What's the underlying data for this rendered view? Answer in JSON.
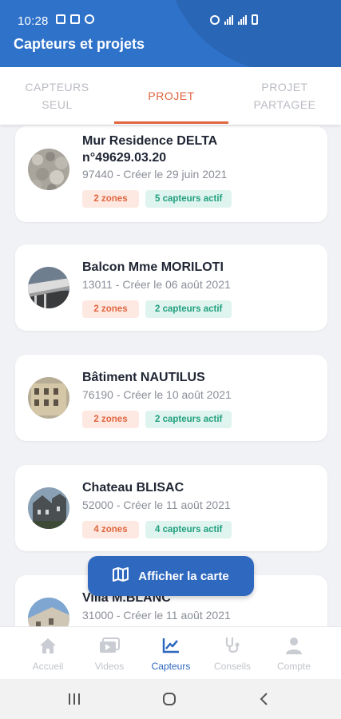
{
  "status": {
    "time": "10:28"
  },
  "header": {
    "title": "Capteurs et projets"
  },
  "tabs": [
    {
      "line1": "CAPTEURS",
      "line2": "SEUL"
    },
    {
      "line1": "PROJET",
      "line2": ""
    },
    {
      "line1": "PROJET",
      "line2": "PARTAGEE"
    }
  ],
  "projects": [
    {
      "name_line1": "Mur Residence DELTA",
      "name_line2": "n°49629.03.20",
      "subtitle": "97440 - Créer le 29 juin 2021",
      "zones": "2 zones",
      "sensors": "5 capteurs actif"
    },
    {
      "name_line1": "Balcon Mme MORILOTI",
      "name_line2": "",
      "subtitle": "13011 - Créer le 06 août 2021",
      "zones": "2 zones",
      "sensors": "2 capteurs actif"
    },
    {
      "name_line1": "Bâtiment NAUTILUS",
      "name_line2": "",
      "subtitle": "76190 - Créer le 10 août 2021",
      "zones": "2 zones",
      "sensors": "2 capteurs actif"
    },
    {
      "name_line1": "Chateau BLISAC",
      "name_line2": "",
      "subtitle": "52000 - Créer le 11 août 2021",
      "zones": "4 zones",
      "sensors": "4 capteurs actif"
    },
    {
      "name_line1": "Villa M.BLANC",
      "name_line2": "",
      "subtitle": "31000 - Créer le 11 août 2021",
      "zones": "",
      "sensors": ""
    }
  ],
  "map_button": {
    "label": "Afficher la carte",
    "icon": "map-icon"
  },
  "bottom_nav": [
    {
      "label": "Accueil",
      "icon": "home-icon"
    },
    {
      "label": "Videos",
      "icon": "video-icon"
    },
    {
      "label": "Capteurs",
      "icon": "chart-icon"
    },
    {
      "label": "Conseils",
      "icon": "stethoscope-icon"
    },
    {
      "label": "Compte",
      "icon": "user-icon"
    }
  ],
  "colors": {
    "primary": "#2f72c9",
    "accent": "#e0653f",
    "success": "#22a07f"
  }
}
